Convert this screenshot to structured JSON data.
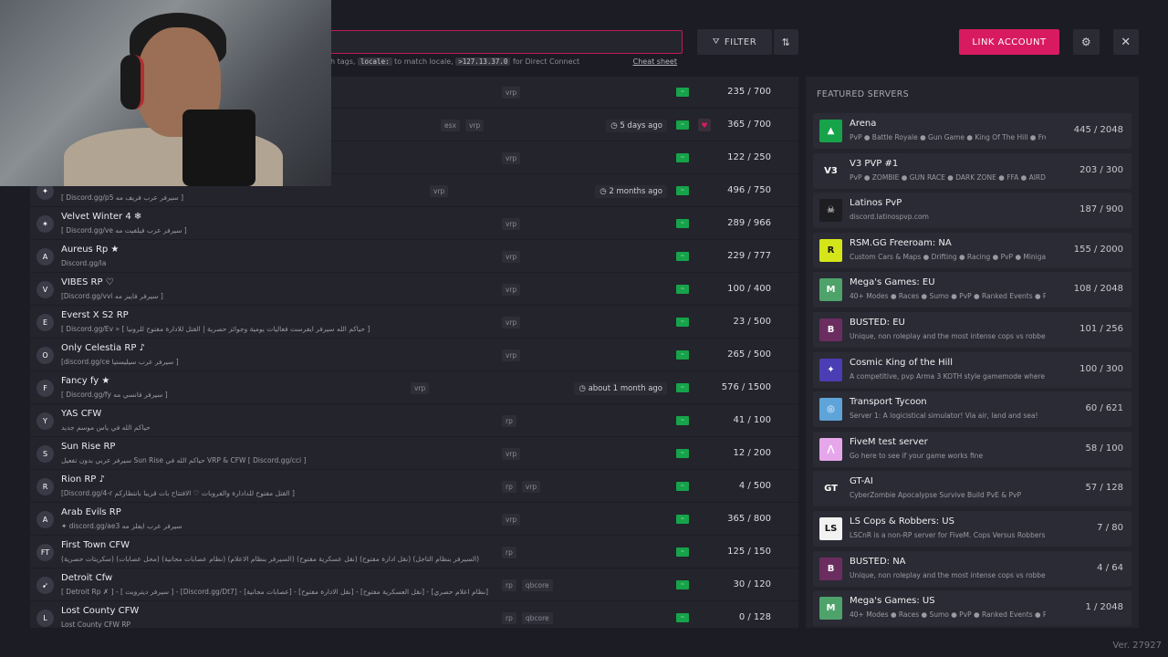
{
  "header": {
    "search_placeholder": "",
    "hint_prefix": "h tags,",
    "hint_code1": "locale:",
    "hint_mid": "to match locale,",
    "hint_code2": ">127.13.37.0",
    "hint_suffix": "for Direct Connect",
    "cheat_sheet": "Cheat sheet",
    "filter_label": "FILTER",
    "sort_icon": "⇅",
    "link_account_label": "LINK ACCOUNT",
    "gear_icon": "⚙",
    "close_icon": "✕"
  },
  "servers": [
    {
      "name": "",
      "desc": "",
      "tags": [
        "vrp"
      ],
      "updated": "",
      "fav": false,
      "players": "235 / 700",
      "icon": ""
    },
    {
      "name": "",
      "desc": "",
      "tags": [
        "esx",
        "vrp"
      ],
      "updated": "5 days ago",
      "fav": true,
      "players": "365 / 700",
      "icon": ""
    },
    {
      "name": "",
      "desc": "",
      "tags": [
        "vrp"
      ],
      "updated": "",
      "fav": false,
      "players": "122 / 250",
      "icon": ""
    },
    {
      "name": "",
      "desc": "[ Discord.gg/p5 سيرفر عرب فريف مه ]",
      "tags": [
        "vrp"
      ],
      "updated": "2 months ago",
      "fav": false,
      "players": "496 / 750",
      "icon": "✦"
    },
    {
      "name": "Velvet Winter 4 ❄",
      "desc": "[ Discord.gg/ve سيرفر عرب فيلفيت مه ]",
      "tags": [
        "vrp"
      ],
      "updated": "",
      "fav": false,
      "players": "289 / 966",
      "icon": "✶"
    },
    {
      "name": "Aureus Rp ★",
      "desc": "Discord.gg/la",
      "tags": [
        "vrp"
      ],
      "updated": "",
      "fav": false,
      "players": "229 / 777",
      "icon": "A"
    },
    {
      "name": "VIBES RP ♡",
      "desc": "[Discord.gg/vvi سيرفر فايبز مه ]",
      "tags": [
        "vrp"
      ],
      "updated": "",
      "fav": false,
      "players": "100 / 400",
      "icon": "V"
    },
    {
      "name": "Everst X S2 RP",
      "desc": "[ Discord.gg/Ev » [ حياكم الله سيرفر ايفرست فعاليات يومية وجوائز حصرية | القتل للادارة مفتوح للرونيا ]",
      "tags": [
        "vrp"
      ],
      "updated": "",
      "fav": false,
      "players": "23 / 500",
      "icon": "E"
    },
    {
      "name": "Only Celestia RP ♪",
      "desc": "[discord.gg/ce سيرفر عرب سيليستيا ]",
      "tags": [
        "vrp"
      ],
      "updated": "",
      "fav": false,
      "players": "265 / 500",
      "icon": "O"
    },
    {
      "name": "Fancy fy ★",
      "desc": "[ Discord.gg/fy سيرفر فانسي مه ]",
      "tags": [
        "vrp"
      ],
      "updated": "about 1 month ago",
      "fav": false,
      "players": "576 / 1500",
      "icon": "F"
    },
    {
      "name": "YAS CFW",
      "desc": "حياكم الله في ياس موسم جديد",
      "tags": [
        "rp"
      ],
      "updated": "",
      "fav": false,
      "players": "41 / 100",
      "icon": "Y"
    },
    {
      "name": "Sun Rise RP",
      "desc": "سيرفر عربي بدون تفعيل Sun Rise حياكم الله في VRP & CFW [ Discord.gg/cci ]",
      "tags": [
        "vrp"
      ],
      "updated": "",
      "fav": false,
      "players": "12 / 200",
      "icon": "S"
    },
    {
      "name": "Rion RP ♪",
      "desc": "[Discord.gg/4-r القتل مفتوح للدادارة والفروبات ♡ الافتتاح بات قريبا بانتظاركم ]",
      "tags": [
        "rp",
        "vrp"
      ],
      "updated": "",
      "fav": false,
      "players": "4 / 500",
      "icon": "R"
    },
    {
      "name": "Arab Evils RP",
      "desc": "✦ discord.gg/ae3 سيرفر عرب ايفلز مه",
      "tags": [
        "vrp"
      ],
      "updated": "",
      "fav": false,
      "players": "365 / 800",
      "icon": "A"
    },
    {
      "name": "First Town CFW",
      "desc": "(سكريتات حصرية) (محل عصابات) (نظام عصابات مجانية) (السيرفر بنظام الاعلام) (نقل عسكرية مفتوح) (نقل ادارة مفتوح) (السيرفر بنظام التاجل)",
      "tags": [
        "rp"
      ],
      "updated": "",
      "fav": false,
      "players": "125 / 150",
      "icon": "FT"
    },
    {
      "name": "Detroit Cfw",
      "desc": "[ Detroit Rp ✗ ] - [ سيرفر ديترويت ] - [Discord.gg/Dt7] - [عصابات مجانية] - [نقل الادارة مفتوح] - [نقل العسكرية مفتوح] - [نظام اعلام حصري]",
      "tags": [
        "rp",
        "qbcore"
      ],
      "updated": "",
      "fav": false,
      "players": "30 / 120",
      "icon": "➹"
    },
    {
      "name": "Lost County CFW",
      "desc": "Lost County CFW RP",
      "tags": [
        "rp",
        "qbcore"
      ],
      "updated": "",
      "fav": false,
      "players": "0 / 128",
      "icon": "L"
    }
  ],
  "featured": {
    "title": "FEATURED SERVERS",
    "items": [
      {
        "name": "Arena",
        "desc": "PvP ● Battle Royale ● Gun Game ● King Of The Hill ● Freeroam",
        "players": "445 / 2048",
        "icon": "▲",
        "color": "#16a34a"
      },
      {
        "name": "V3 PVP #1",
        "desc": "PvP ● ZOMBIE ● GUN RACE ● DARK ZONE ● FFA ● AIRDROP",
        "players": "203 / 300",
        "icon": "V3",
        "color": "#2a2b34"
      },
      {
        "name": "Latinos PvP",
        "desc": "discord.latinospvp.com",
        "players": "187 / 900",
        "icon": "☠",
        "color": "#1d1d22"
      },
      {
        "name": "RSM.GG Freeroam: NA",
        "desc": "Custom Cars & Maps ● Drifting ● Racing ● PvP ● Minigames",
        "players": "155 / 2000",
        "icon": "R",
        "color": "#d4e51a"
      },
      {
        "name": "Mega's Games: EU",
        "desc": "40+ Modes ● Races ● Sumo ● PvP ● Ranked Events ● Parties",
        "players": "108 / 2048",
        "icon": "M",
        "color": "#4ea36b"
      },
      {
        "name": "BUSTED: EU",
        "desc": "Unique, non roleplay and the most intense cops vs robbers experience",
        "players": "101 / 256",
        "icon": "B",
        "color": "#6b2d5f"
      },
      {
        "name": "Cosmic King of the Hill",
        "desc": "A competitive, pvp Arma 3 KOTH style gamemode where anyone",
        "players": "100 / 300",
        "icon": "✦",
        "color": "#4b3db3"
      },
      {
        "name": "Transport Tycoon",
        "desc": "Server 1: A logicistical simulator! Via air, land and sea!",
        "players": "60 / 621",
        "icon": "◎",
        "color": "#5fa4d9"
      },
      {
        "name": "FiveM test server",
        "desc": "Go here to see if your game works fine",
        "players": "58 / 100",
        "icon": "⋀",
        "color": "#e6a7ea"
      },
      {
        "name": "GT-AI",
        "desc": "CyberZombie Apocalypse Survive Build PvE & PvP",
        "players": "57 / 128",
        "icon": "GT",
        "color": "#2a2b34"
      },
      {
        "name": "LS Cops & Robbers: US",
        "desc": "LSCnR is a non-RP server for FiveM. Cops Versus Robbers freeroam",
        "players": "7 / 80",
        "icon": "LS",
        "color": "#f2f2f2"
      },
      {
        "name": "BUSTED: NA",
        "desc": "Unique, non roleplay and the most intense cops vs robbers experience",
        "players": "4 / 64",
        "icon": "B",
        "color": "#6b2d5f"
      },
      {
        "name": "Mega's Games: US",
        "desc": "40+ Modes ● Races ● Sumo ● PvP ● Ranked Events ● Parties",
        "players": "1 / 2048",
        "icon": "M",
        "color": "#4ea36b"
      }
    ]
  },
  "version": "Ver. 27927",
  "colors": {
    "accent": "#d81b60",
    "flag": "#16a34a",
    "bg": "#1b1c24",
    "panel": "#23242c"
  }
}
